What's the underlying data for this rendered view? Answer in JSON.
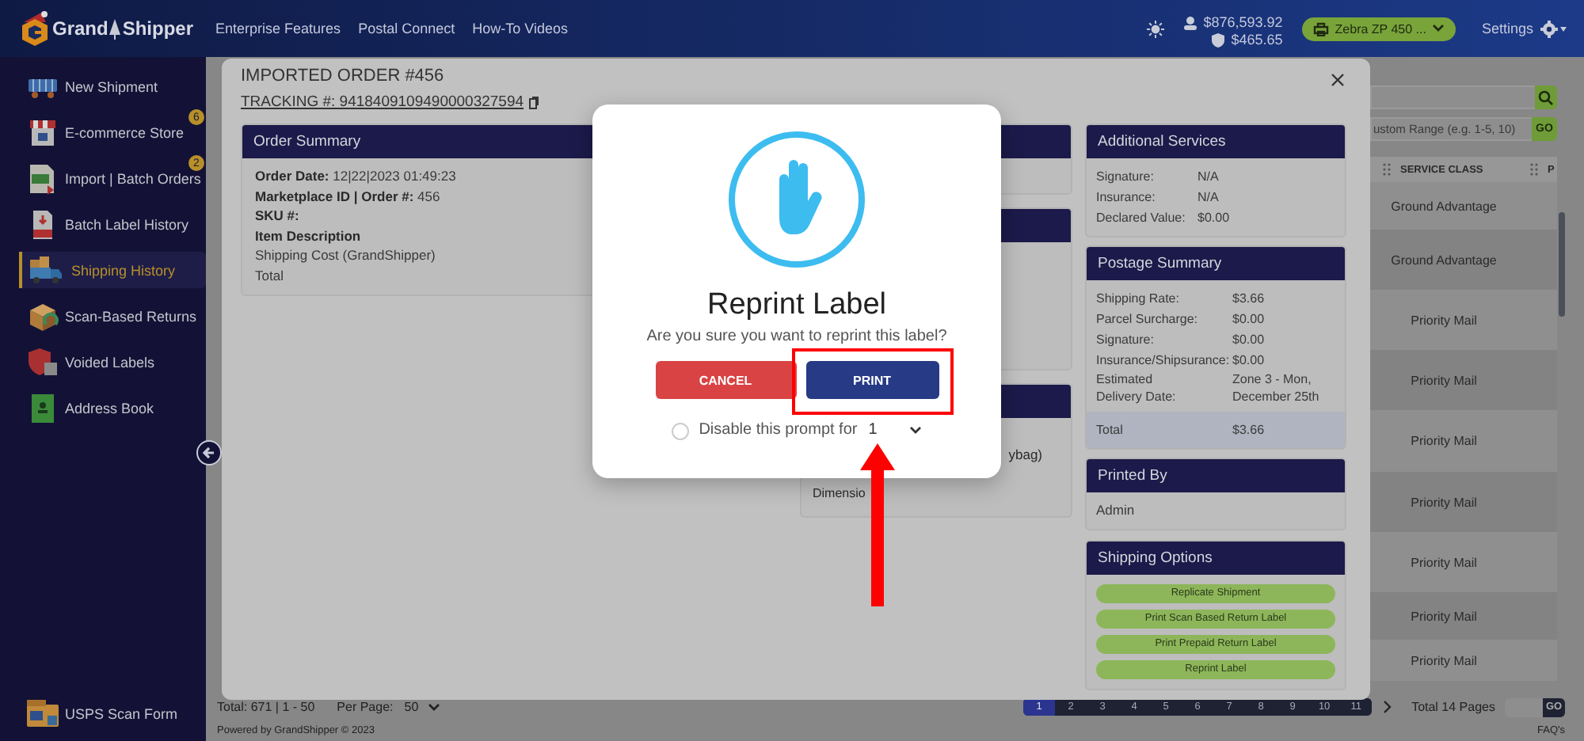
{
  "topbar": {
    "logo_words": [
      "Grand",
      "Shipper"
    ],
    "nav": [
      "Enterprise Features",
      "Postal Connect",
      "How-To Videos"
    ],
    "balances": [
      "$876,593.92",
      "$465.65"
    ],
    "printer": "Zebra ZP 450 ...",
    "settings": "Settings"
  },
  "sidebar": {
    "items": [
      {
        "label": "New Shipment",
        "selected": false
      },
      {
        "label": "E-commerce Store",
        "badge": "6",
        "selected": false
      },
      {
        "label": "Import | Batch Orders",
        "badge": "2",
        "selected": false
      },
      {
        "label": "Batch Label History",
        "selected": false
      },
      {
        "label": "Shipping History",
        "selected": true
      },
      {
        "label": "Scan-Based Returns",
        "selected": false
      },
      {
        "label": "Voided Labels",
        "selected": false
      },
      {
        "label": "Address Book",
        "selected": false
      }
    ],
    "bottom_item": {
      "label": "USPS Scan Form"
    }
  },
  "shipments": {
    "range_field": {
      "placeholder": "ustom Range (e.g. 1-5, 10)"
    },
    "go_button": "GO",
    "table": {
      "columns": [
        "SERVICE CLASS",
        "P"
      ],
      "rows": [
        {
          "service_class": "Ground Advantage"
        },
        {
          "service_class": "Ground Advantage"
        },
        {
          "service_class": "Priority Mail"
        },
        {
          "service_class": "Priority Mail"
        },
        {
          "service_class": "Priority Mail"
        },
        {
          "service_class": "Priority Mail"
        },
        {
          "service_class": "Priority Mail"
        },
        {
          "service_class": "Priority Mail"
        },
        {
          "service_class": "Priority Mail"
        }
      ]
    }
  },
  "footer": {
    "summary": "Total: 671 | 1 - 50",
    "per_page_label": "Per Page:",
    "per_page": "50",
    "pages": [
      {
        "label": "1",
        "selected": true
      },
      {
        "label": "2",
        "selected": false
      },
      {
        "label": "3",
        "selected": false
      },
      {
        "label": "4",
        "selected": false
      },
      {
        "label": "5",
        "selected": false
      },
      {
        "label": "6",
        "selected": false
      },
      {
        "label": "7",
        "selected": false
      },
      {
        "label": "8",
        "selected": false
      },
      {
        "label": "9",
        "selected": false
      },
      {
        "label": "10",
        "selected": false
      },
      {
        "label": "11",
        "selected": false
      }
    ],
    "total_pages": "Total 14 Pages",
    "go_button": "GO",
    "powered_by": "Powered by GrandShipper © 2023",
    "faq": "FAQ's"
  },
  "order": {
    "title": "IMPORTED ORDER #456",
    "tracking": "TRACKING #: 9418409109490000327594",
    "order_summary": {
      "title": "Order Summary",
      "rows": [
        {
          "kind": "field",
          "label": "Order Date:",
          "value": "12|22|2023 01:49:23"
        },
        {
          "kind": "field",
          "label": "Marketplace ID | Order #:",
          "value": "456"
        },
        {
          "kind": "field",
          "label": "SKU #:"
        },
        {
          "kind": "heading",
          "label": "Item Description"
        },
        {
          "kind": "line",
          "label": "Shipping Cost (GrandShipper)"
        },
        {
          "kind": "line",
          "label": "Total"
        }
      ]
    },
    "middle_fragments": [
      "ybag)",
      "Dimensio"
    ],
    "additional_services": {
      "title": "Additional Services",
      "rows": [
        {
          "label": "Signature:",
          "value": "N/A"
        },
        {
          "label": "Insurance:",
          "value": "N/A"
        },
        {
          "label": "Declared Value:",
          "value": "$0.00"
        }
      ]
    },
    "postage_summary": {
      "title": "Postage Summary",
      "rows": [
        {
          "label": "Shipping Rate:",
          "value": "$3.66"
        },
        {
          "label": "Parcel Surcharge:",
          "value": "$0.00"
        },
        {
          "label": "Signature:",
          "value": "$0.00"
        },
        {
          "label": "Insurance/Shipsurance:",
          "value": "$0.00"
        },
        {
          "label": "Estimated Delivery Date:",
          "value": "Zone 3 - Mon, December 25th"
        }
      ],
      "total": {
        "label": "Total",
        "value": "$3.66"
      }
    },
    "printed_by": {
      "title": "Printed By",
      "value": "Admin"
    },
    "shipping_options": {
      "title": "Shipping Options",
      "buttons": [
        "Replicate Shipment",
        "Print Scan Based Return Label",
        "Print Prepaid Return Label",
        "Reprint Label"
      ]
    }
  },
  "dialog": {
    "title": "Reprint Label",
    "message": "Are you sure you want to reprint this label?",
    "buttons": [
      {
        "label": "CANCEL",
        "kind": "cancel"
      },
      {
        "label": "PRINT",
        "kind": "confirm"
      }
    ],
    "disable_prompt": {
      "label": "Disable this prompt for",
      "checked": false,
      "value": "1"
    }
  },
  "annotations": {
    "highlight_box": true,
    "arrow": true
  }
}
